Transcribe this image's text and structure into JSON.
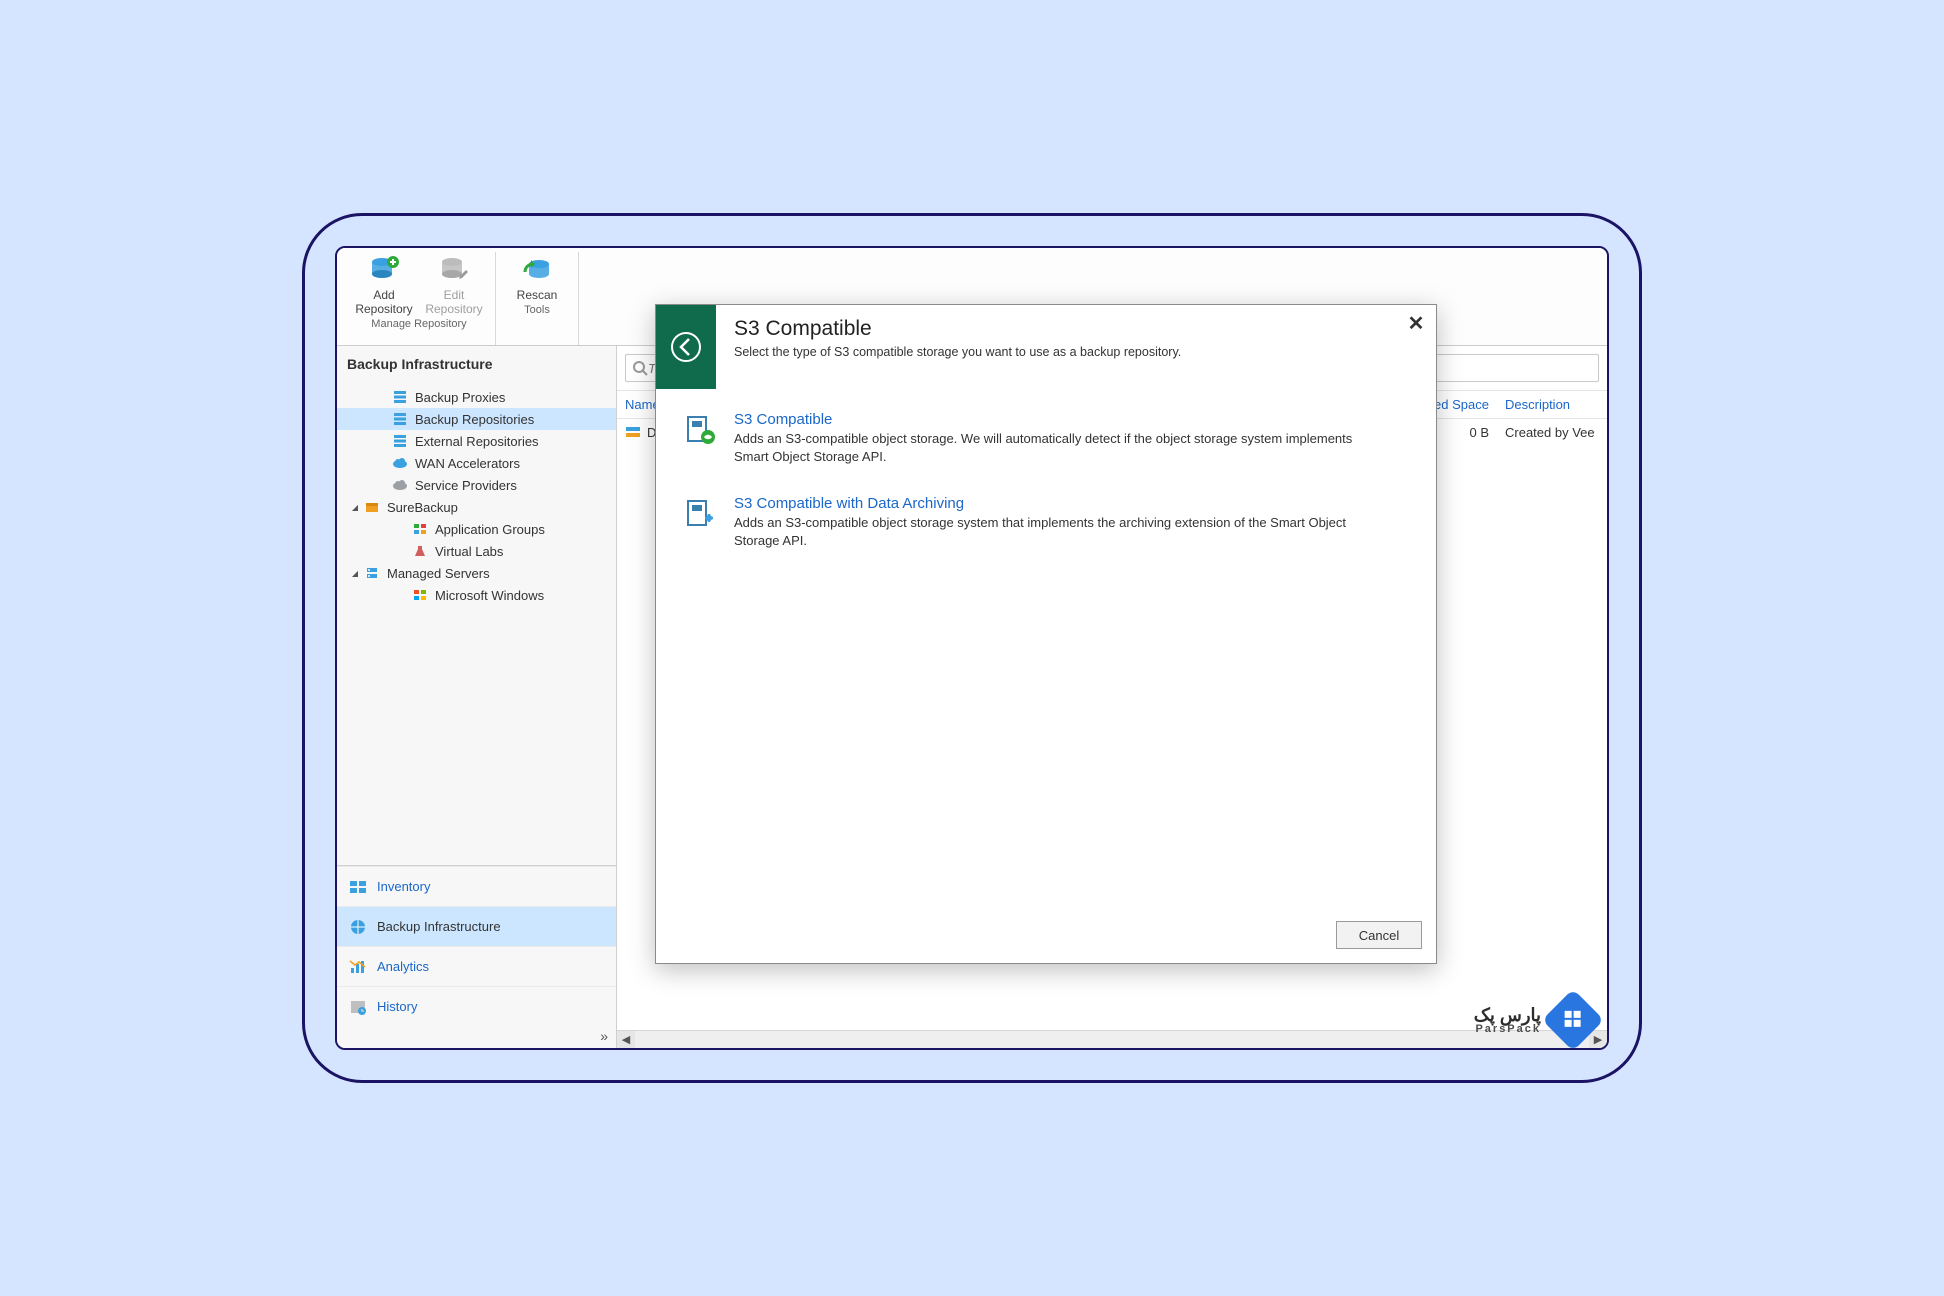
{
  "ribbon": {
    "groups": [
      {
        "label": "Manage Repository",
        "buttons": [
          {
            "label": "Add\nRepository",
            "name": "add-repository-button",
            "disabled": false
          },
          {
            "label": "Edit\nRepository",
            "name": "edit-repository-button",
            "disabled": true
          }
        ]
      },
      {
        "label": "Tools",
        "buttons": [
          {
            "label": "Rescan",
            "name": "rescan-button",
            "disabled": false
          }
        ]
      }
    ]
  },
  "sidebar": {
    "title": "Backup Infrastructure",
    "tree": [
      {
        "label": "Backup Proxies",
        "name": "tree-backup-proxies",
        "indent": 1,
        "icon": "stack-blue"
      },
      {
        "label": "Backup Repositories",
        "name": "tree-backup-repositories",
        "indent": 1,
        "icon": "stack-blue",
        "selected": true
      },
      {
        "label": "External Repositories",
        "name": "tree-external-repositories",
        "indent": 1,
        "icon": "stack-blue"
      },
      {
        "label": "WAN Accelerators",
        "name": "tree-wan-accelerators",
        "indent": 1,
        "icon": "cloud-blue"
      },
      {
        "label": "Service Providers",
        "name": "tree-service-providers",
        "indent": 1,
        "icon": "cloud-grey"
      },
      {
        "label": "SureBackup",
        "name": "tree-surebackup",
        "indent": 0,
        "icon": "box-orange",
        "caret": "▲"
      },
      {
        "label": "Application Groups",
        "name": "tree-application-groups",
        "indent": 2,
        "icon": "grid-green"
      },
      {
        "label": "Virtual Labs",
        "name": "tree-virtual-labs",
        "indent": 2,
        "icon": "flask"
      },
      {
        "label": "Managed Servers",
        "name": "tree-managed-servers",
        "indent": 0,
        "icon": "server-blue",
        "caret": "▲"
      },
      {
        "label": "Microsoft Windows",
        "name": "tree-ms-windows",
        "indent": 2,
        "icon": "windows"
      }
    ],
    "nav": [
      {
        "label": "Inventory",
        "name": "nav-inventory",
        "icon": "inventory"
      },
      {
        "label": "Backup Infrastructure",
        "name": "nav-backup-infra",
        "icon": "globe",
        "active": true
      },
      {
        "label": "Analytics",
        "name": "nav-analytics",
        "icon": "analytics"
      },
      {
        "label": "History",
        "name": "nav-history",
        "icon": "history"
      }
    ],
    "expand_glyph": "»"
  },
  "main": {
    "search_placeholder": "T",
    "columns": {
      "name": "Name",
      "used": "Used Space",
      "desc": "Description"
    },
    "rows": [
      {
        "name": "De",
        "used": "0 B",
        "desc": "Created by Vee"
      }
    ]
  },
  "dialog": {
    "title": "S3 Compatible",
    "subtitle": "Select the type of S3 compatible storage you want to use as a backup repository.",
    "options": [
      {
        "title": "S3 Compatible",
        "desc": "Adds an S3-compatible object storage. We will automatically detect if the object storage system implements Smart Object Storage API.",
        "name": "option-s3-compatible"
      },
      {
        "title": "S3 Compatible with Data Archiving",
        "desc": "Adds an S3-compatible object storage system that implements the archiving extension of the Smart Object Storage API.",
        "name": "option-s3-archiving"
      }
    ],
    "cancel": "Cancel"
  },
  "watermark": {
    "line1": "پارس پک",
    "line2": "ParsPack"
  }
}
